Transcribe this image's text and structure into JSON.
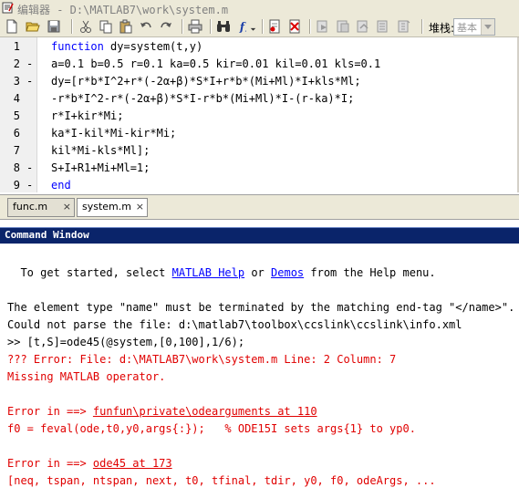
{
  "window": {
    "title": "编辑器 - D:\\MATLAB7\\work\\system.m"
  },
  "toolbar": {
    "stack_label": "堆栈:",
    "stack_value": "基本"
  },
  "editor": {
    "lines": [
      {
        "num": "1",
        "dash": "",
        "kw": "function",
        "text": " dy=system(t,y)"
      },
      {
        "num": "2",
        "dash": "-",
        "kw": "",
        "text": "a=0.1 b=0.5 r=0.1 ka=0.5 kir=0.01 kil=0.01 kls=0.1"
      },
      {
        "num": "3",
        "dash": "-",
        "kw": "",
        "text": "dy=[r*b*I^2+r*(-2α+β)*S*I+r*b*(Mi+Ml)*I+kls*Ml;"
      },
      {
        "num": "4",
        "dash": "",
        "kw": "",
        "text": "-r*b*I^2-r*(-2α+β)*S*I-r*b*(Mi+Ml)*I-(r-ka)*I;"
      },
      {
        "num": "5",
        "dash": "",
        "kw": "",
        "text": "r*I+kir*Mi;"
      },
      {
        "num": "6",
        "dash": "",
        "kw": "",
        "text": "ka*I-kil*Mi-kir*Mi;"
      },
      {
        "num": "7",
        "dash": "",
        "kw": "",
        "text": "kil*Mi-kls*Ml];"
      },
      {
        "num": "8",
        "dash": "-",
        "kw": "",
        "text": "S+I+R1+Mi+Ml=1;"
      },
      {
        "num": "9",
        "dash": "-",
        "kw": "end",
        "text": ""
      }
    ]
  },
  "tabs": [
    {
      "label": "func.m",
      "close": "×"
    },
    {
      "label": "system.m",
      "close": "×"
    }
  ],
  "command_window": {
    "header": "Command Window",
    "getting_started": {
      "prefix": "  To get started, select ",
      "link1": "MATLAB Help",
      "mid": " or ",
      "link2": "Demos",
      "suffix": " from the Help menu."
    },
    "warn1": "The element type \"name\" must be terminated by the matching end-tag \"</name>\".",
    "warn2": "Could not parse the file: d:\\matlab7\\toolbox\\ccslink\\ccslink\\info.xml",
    "prompt": ">> [t,S]=ode45(@system,[0,100],1/6);",
    "error1": "??? Error: File: d:\\MATLAB7\\work\\system.m Line: 2 Column: 7",
    "error2": "Missing MATLAB operator.",
    "errin1": {
      "prefix": "Error in ==> ",
      "link": "funfun\\private\\odearguments at 110"
    },
    "errcode1": "f0 = feval(ode,t0,y0,args{:});   % ODE15I sets args{1} to yp0.",
    "errin2": {
      "prefix": "Error in ==> ",
      "link": "ode45 at 173"
    },
    "errcode2": "[neq, tspan, ntspan, next, t0, tfinal, tdir, y0, f0, odeArgs, ..."
  }
}
